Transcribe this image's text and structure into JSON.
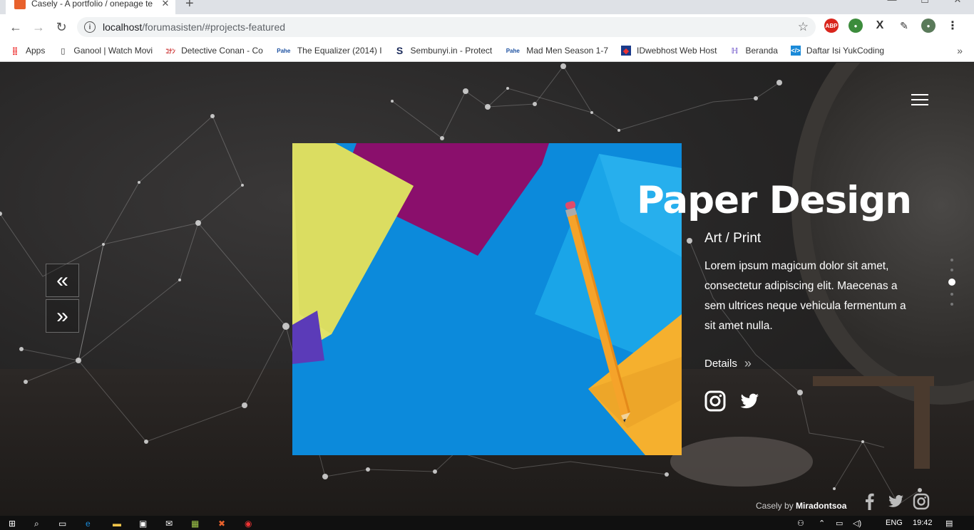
{
  "browser": {
    "tab_title": "Casely - A portfolio / onepage te",
    "url_host": "localhost",
    "url_path": "/forumasisten/#projects-featured",
    "bookmarks": [
      {
        "label": "Apps",
        "icon": "apps-grid-icon"
      },
      {
        "label": "Ganool | Watch Movi",
        "icon": "page-icon"
      },
      {
        "label": "Detective Conan - Co",
        "icon": "site-icon"
      },
      {
        "label": "The Equalizer (2014) I",
        "icon": "pahe-icon"
      },
      {
        "label": "Sembunyi.in - Protect",
        "icon": "s-icon"
      },
      {
        "label": "Mad Men Season 1-7",
        "icon": "pahe-icon"
      },
      {
        "label": "IDwebhost Web Host",
        "icon": "idwebhost-icon"
      },
      {
        "label": "Beranda",
        "icon": "beranda-icon"
      },
      {
        "label": "Daftar Isi YukCoding",
        "icon": "code-icon"
      }
    ]
  },
  "project": {
    "title": "Paper Design",
    "category": "Art / Print",
    "description": "Lorem ipsum magicum dolor sit amet, consectetur adipiscing elit. Maecenas a sem ultrices neque vehicula fermentum a sit amet nulla.",
    "details_label": "Details"
  },
  "footer": {
    "credit_prefix": "Casely by",
    "credit_author": "Miradontsoa"
  },
  "taskbar": {
    "lang": "ENG",
    "time": "19:42"
  },
  "colors": {
    "accent_blue": "#0a87d8",
    "paper_purple": "#8a0f6c",
    "paper_yellow": "#e2e36a",
    "paper_orange": "#f5b02e"
  }
}
